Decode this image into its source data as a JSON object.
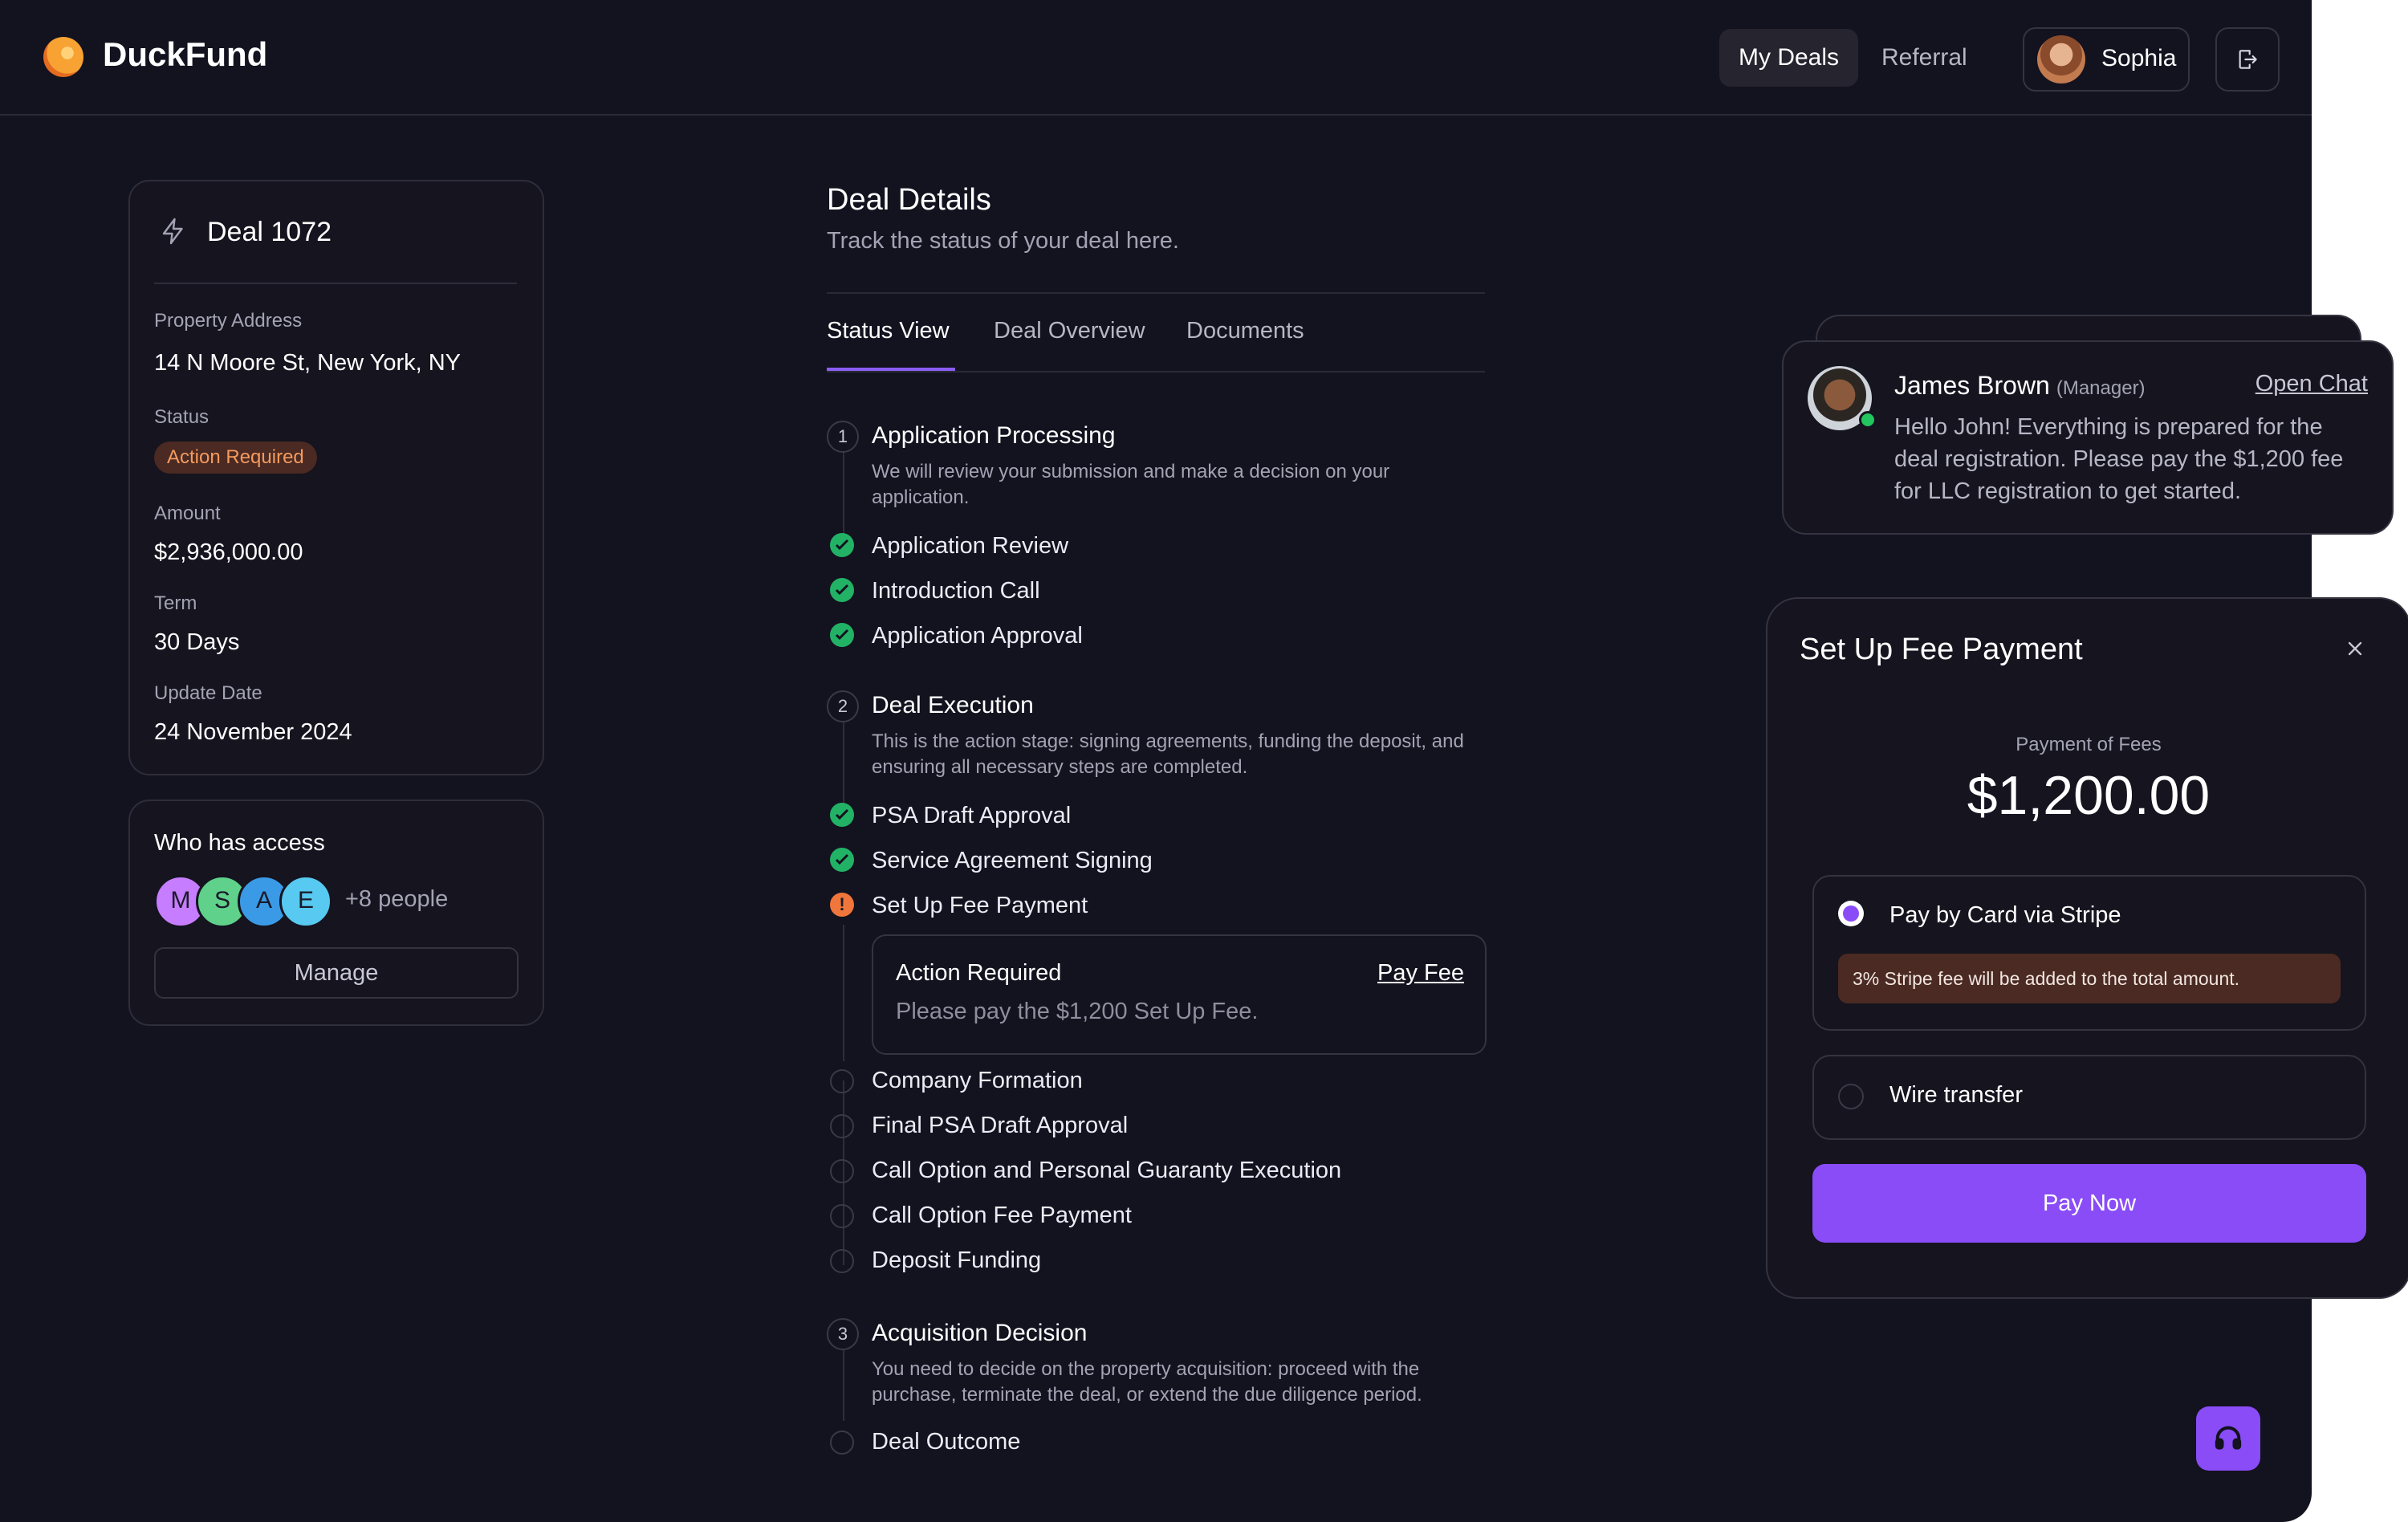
{
  "header": {
    "brand": "DuckFund",
    "nav": [
      "My Deals",
      "Referral"
    ],
    "user": "Sophia"
  },
  "deal": {
    "title": "Deal 1072",
    "fields": [
      {
        "label": "Property Address",
        "value": "14 N Moore St, New York, NY"
      },
      {
        "label": "Status",
        "value": "Action Required"
      },
      {
        "label": "Amount",
        "value": "$2,936,000.00"
      },
      {
        "label": "Term",
        "value": "30 Days"
      },
      {
        "label": "Update Date",
        "value": "24 November 2024"
      }
    ]
  },
  "access": {
    "title": "Who has access",
    "avatars": [
      {
        "initial": "M",
        "color": "#c77dff"
      },
      {
        "initial": "S",
        "color": "#5fd18b"
      },
      {
        "initial": "A",
        "color": "#3b9ae6"
      },
      {
        "initial": "E",
        "color": "#58c9f0"
      }
    ],
    "more": "+8 people",
    "manage": "Manage"
  },
  "details": {
    "title": "Deal Details",
    "subtitle": "Track the status of your deal here.",
    "tabs": [
      "Status View",
      "Deal Overview",
      "Documents"
    ]
  },
  "steps": [
    {
      "num": "1",
      "title": "Application Processing",
      "desc": "We will review your submission and make a decision on your application.",
      "items": [
        "Application Review",
        "Introduction Call",
        "Application Approval"
      ]
    },
    {
      "num": "2",
      "title": "Deal Execution",
      "desc": "This is the action stage: signing agreements, funding the deposit, and ensuring all necessary steps are completed.",
      "items": [
        "PSA Draft Approval",
        "Service Agreement Signing",
        "Set Up Fee Payment",
        "Company Formation",
        "Final PSA Draft Approval",
        "Call Option and Personal Guaranty Execution",
        "Call Option Fee Payment",
        "Deposit Funding"
      ]
    },
    {
      "num": "3",
      "title": "Acquisition Decision",
      "desc": "You need to decide on the property acquisition: proceed with the purchase, terminate the deal, or extend the due diligence period.",
      "items": [
        "Deal Outcome"
      ]
    }
  ],
  "action_box": {
    "title": "Action Required",
    "text": "Please pay the $1,200 Set Up Fee.",
    "link": "Pay Fee"
  },
  "chat": {
    "name": "James Brown",
    "role": "(Manager)",
    "open": "Open Chat",
    "message": "Hello John! Everything is prepared for the deal registration. Please pay the $1,200 fee for LLC registration to get started."
  },
  "payment": {
    "title": "Set Up Fee Payment",
    "fee_label": "Payment of Fees",
    "amount": "$1,200.00",
    "option_card": "Pay by Card via Stripe",
    "stripe_note": "3% Stripe fee will be added to the total amount.",
    "option_wire": "Wire transfer",
    "pay_now": "Pay Now"
  },
  "colors": {
    "background": "#13121f",
    "accent": "#8a4cf7",
    "success": "#22b266",
    "warning": "#f0763c"
  }
}
